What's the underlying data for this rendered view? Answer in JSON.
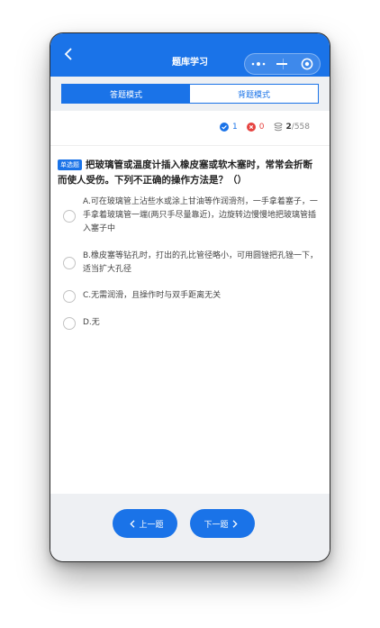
{
  "navbar": {
    "title": "题库学习",
    "back_icon": "chevron-left-icon",
    "capsule": {
      "more_icon": "more-dots-icon",
      "minimize_icon": "minimize-icon",
      "close_icon": "target-icon"
    }
  },
  "mode_tabs": [
    {
      "label": "答题模式",
      "active": true
    },
    {
      "label": "背题模式",
      "active": false
    }
  ],
  "stats": {
    "correct": "1",
    "wrong": "0",
    "progress_current": "2",
    "progress_total": "/558",
    "colors": {
      "correct": "#1a73e8",
      "wrong": "#e64340"
    }
  },
  "question": {
    "type_tag": "单选题",
    "text": "把玻璃管或温度计插入橡皮塞或软木塞时，常常会折断而使人受伤。下列不正确的操作方法是？（）",
    "options": [
      {
        "text": "A.可在玻璃管上沾些水或涂上甘油等作润滑剂，一手拿着塞子，一手拿着玻璃管一端(两只手尽量靠近)，边旋转边慢慢地把玻璃管插入塞子中"
      },
      {
        "text": "B.橡皮塞等钻孔时，打出的孔比管径略小，可用圆锉把孔锉一下，适当扩大孔径"
      },
      {
        "text": "C.无需润滑，且操作时与双手距离无关"
      },
      {
        "text": "D.无"
      }
    ]
  },
  "footer": {
    "prev_label": "上一题",
    "next_label": "下一题"
  },
  "theme": {
    "accent": "#1a73e8",
    "background": "#eef0f3"
  }
}
